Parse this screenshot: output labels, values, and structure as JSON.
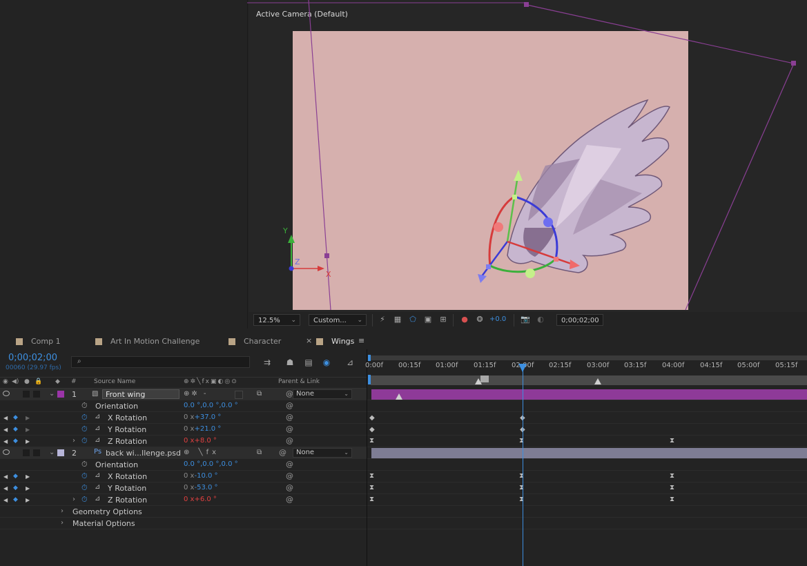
{
  "viewer": {
    "camera_label": "Active Camera (Default)",
    "zoom": "12.5%",
    "resolution": "Custom...",
    "exposure": "+0.0",
    "timecode": "0;00;02;00",
    "axis_labels": {
      "y": "Y",
      "z": "Z",
      "x": "X"
    }
  },
  "tabs": [
    {
      "label": "Comp 1"
    },
    {
      "label": "Art In Motion Challenge"
    },
    {
      "label": "Character"
    },
    {
      "label": "Wings",
      "close": "×",
      "menu": "≡"
    }
  ],
  "timeline": {
    "timecode": "0;00;02;00",
    "fps": "00060 (29.97 fps)",
    "search_placeholder": "",
    "columns": {
      "num": "#",
      "source_name": "Source Name",
      "parent": "Parent & Link"
    },
    "ruler_ticks": [
      "0:00f",
      "00:15f",
      "01:00f",
      "01:15f",
      "02:00f",
      "02:15f",
      "03:00f",
      "03:15f",
      "04:00f",
      "04:15f",
      "05:00f",
      "05:15f"
    ],
    "layers": [
      {
        "num": "1",
        "name": "Front wing",
        "color": "#9b35a8",
        "parent": "None",
        "properties": [
          {
            "name": "Orientation",
            "value": "0.0 °,0.0 °,0.0 °"
          },
          {
            "name": "X Rotation",
            "value_x": "0 x",
            "value": "+37.0 °"
          },
          {
            "name": "Y Rotation",
            "value_x": "0 x",
            "value": "+21.0 °"
          },
          {
            "name": "Z Rotation",
            "value_x": "0 x",
            "value": "+8.0 °"
          }
        ]
      },
      {
        "num": "2",
        "name": "back wi...llenge.psd",
        "color": "#b7b5d8",
        "parent": "None",
        "properties": [
          {
            "name": "Orientation",
            "value": "0.0 °,0.0 °,0.0 °"
          },
          {
            "name": "X Rotation",
            "value_x": "0 x",
            "value": "-10.0 °"
          },
          {
            "name": "Y Rotation",
            "value_x": "0 x",
            "value": "-53.0 °"
          },
          {
            "name": "Z Rotation",
            "value_x": "0 x",
            "value": "+6.0 °"
          }
        ]
      }
    ],
    "groups": [
      "Geometry Options",
      "Material Options"
    ]
  },
  "colors": {
    "accent": "#3d8fe0",
    "layer1": "#9b35a8",
    "layer2": "#b7b5d8",
    "comp_bg": "#d6b0ae"
  }
}
